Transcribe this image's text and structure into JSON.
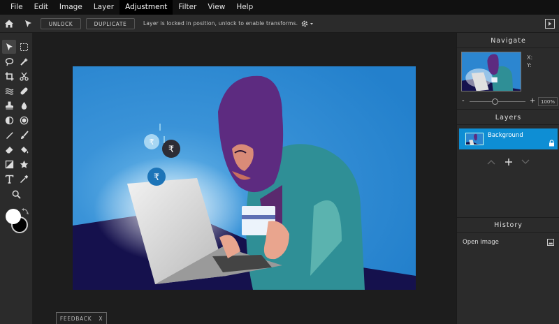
{
  "menu": [
    {
      "label": "File"
    },
    {
      "label": "Edit"
    },
    {
      "label": "Image"
    },
    {
      "label": "Layer"
    },
    {
      "label": "Adjustment",
      "active": true
    },
    {
      "label": "Filter"
    },
    {
      "label": "View"
    },
    {
      "label": "Help"
    }
  ],
  "toolbar": {
    "unlock_label": "UNLOCK",
    "duplicate_label": "DUPLICATE",
    "message": "Layer is locked in position, unlock to enable transforms."
  },
  "navigate": {
    "title": "Navigate",
    "x_label": "X:",
    "y_label": "Y:",
    "zoom_minus": "-",
    "zoom_plus": "+",
    "zoom_value": "100%",
    "zoom_level": 0.45
  },
  "layers": {
    "title": "Layers",
    "items": [
      {
        "name": "Background",
        "locked": true
      }
    ]
  },
  "history": {
    "title": "History",
    "items": [
      {
        "label": "Open image"
      }
    ]
  },
  "feedback": {
    "label": "FEEDBACK",
    "close": "X"
  },
  "colors": {
    "accent": "#0e8ed4",
    "foreground": "#ffffff",
    "background": "#000000",
    "canvas_bg": "#3a8fd6"
  },
  "icons": [
    "home-icon",
    "pointer-icon",
    "settings-icon",
    "panel-toggle-icon",
    "lock-icon",
    "image-icon"
  ],
  "tools": [
    {
      "name": "move-tool"
    },
    {
      "name": "marquee-tool"
    },
    {
      "name": "lasso-tool"
    },
    {
      "name": "magic-wand-tool"
    },
    {
      "name": "crop-tool"
    },
    {
      "name": "slice-tool"
    },
    {
      "name": "liquify-tool"
    },
    {
      "name": "healing-tool"
    },
    {
      "name": "stamp-tool"
    },
    {
      "name": "blur-tool"
    },
    {
      "name": "dodge-tool"
    },
    {
      "name": "sponge-tool"
    },
    {
      "name": "pen-tool"
    },
    {
      "name": "brush-tool"
    },
    {
      "name": "eraser-tool"
    },
    {
      "name": "fill-tool"
    },
    {
      "name": "gradient-tool"
    },
    {
      "name": "shape-tool"
    },
    {
      "name": "text-tool"
    },
    {
      "name": "eyedropper-tool"
    },
    {
      "name": "zoom-tool"
    }
  ]
}
